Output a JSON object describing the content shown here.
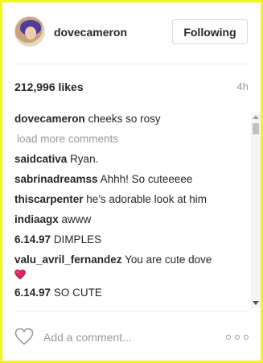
{
  "header": {
    "username": "dovecameron",
    "follow_label": "Following"
  },
  "stats": {
    "likes": "212,996 likes",
    "time": "4h"
  },
  "caption": {
    "user": "dovecameron",
    "text": "cheeks so rosy"
  },
  "load_more": "load more comments",
  "comments": [
    {
      "user": "saidcativa",
      "text": "Ryan."
    },
    {
      "user": "sabrinadreamss",
      "text": "Ahhh! So cuteeeee"
    },
    {
      "user": "thiscarpenter",
      "text": "he's adorable look at him"
    },
    {
      "user": "indiaagx",
      "text": "awww"
    },
    {
      "user": "6.14.97",
      "text": "DIMPLES"
    },
    {
      "user": "valu_avril_fernandez",
      "text": "You are cute dove"
    },
    {
      "user": "6.14.97",
      "text": "SO CUTE"
    }
  ],
  "footer": {
    "comment_placeholder": "Add a comment..."
  },
  "colors": {
    "page_border": "#f4f41c",
    "text": "#262626",
    "muted": "#999999",
    "heart_emoji": "#e0245e"
  },
  "icons": {
    "avatar": "profile-photo",
    "like": "heart-outline-icon",
    "comment_emoji": "red-heart-emoji",
    "more": "three-dots-icon"
  }
}
